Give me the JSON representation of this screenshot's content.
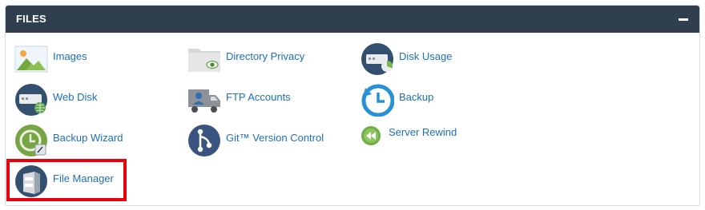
{
  "panel": {
    "title": "FILES",
    "collapse_icon": "minus-icon"
  },
  "items": {
    "images": {
      "label": "Images",
      "icon": "images-icon"
    },
    "directory_privacy": {
      "label": "Directory Privacy",
      "icon": "folder-privacy-icon"
    },
    "disk_usage": {
      "label": "Disk Usage",
      "icon": "disk-usage-icon"
    },
    "web_disk": {
      "label": "Web Disk",
      "icon": "web-disk-icon"
    },
    "ftp_accounts": {
      "label": "FTP Accounts",
      "icon": "ftp-truck-icon"
    },
    "backup": {
      "label": "Backup",
      "icon": "backup-clock-icon"
    },
    "backup_wizard": {
      "label": "Backup Wizard",
      "icon": "backup-wizard-icon"
    },
    "git_version_control": {
      "label": "Git™ Version Control",
      "icon": "git-branch-icon"
    },
    "server_rewind": {
      "label": "Server Rewind",
      "icon": "rewind-icon"
    },
    "file_manager": {
      "label": "File Manager",
      "icon": "file-cabinet-icon"
    }
  },
  "colors": {
    "header_bg": "#2f3f50",
    "link": "#1f6fb5",
    "highlight": "#e8000b"
  }
}
